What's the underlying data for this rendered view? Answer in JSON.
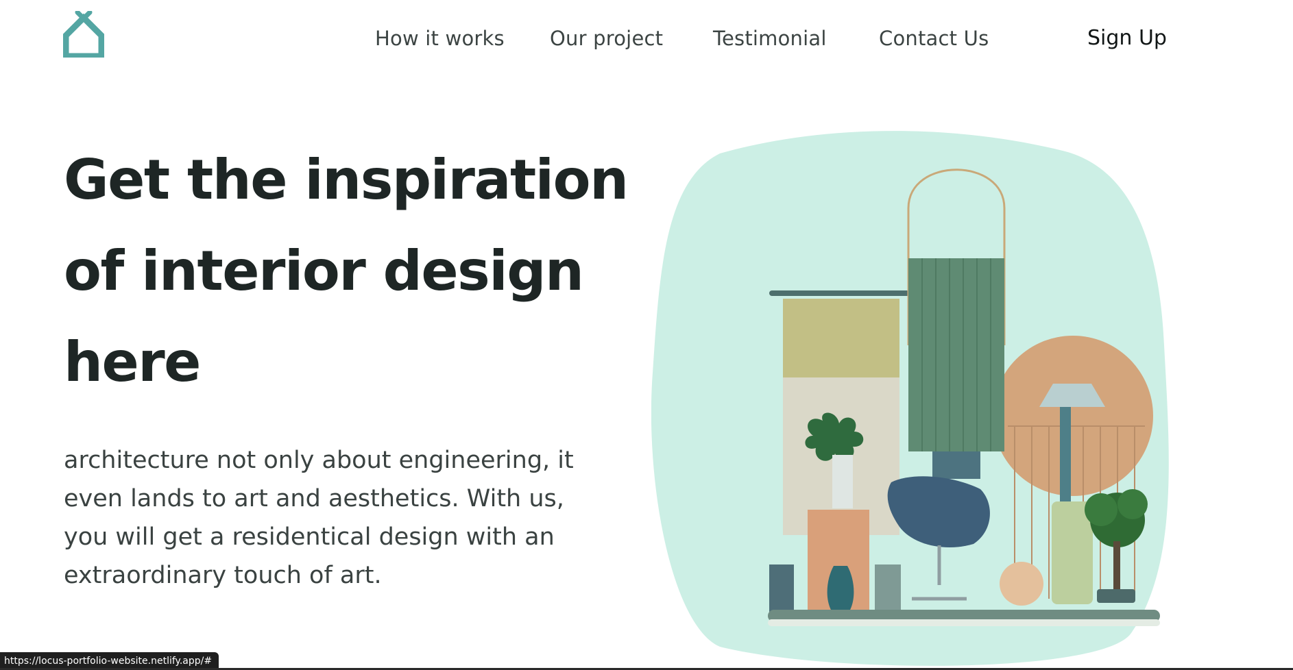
{
  "header": {
    "logo_icon": "house-icon",
    "nav": [
      {
        "label": "How it works"
      },
      {
        "label": "Our project"
      },
      {
        "label": "Testimonial"
      },
      {
        "label": "Contact Us"
      }
    ],
    "signup_label": "Sign Up"
  },
  "hero": {
    "title": "Get the inspiration of interior design here",
    "description": "architecture not only about engineering, it even lands to art and aesthetics. With us, you will get a residentical design with an extraordinary touch of art."
  },
  "illustration": {
    "name": "interior-design-collage",
    "background_color": "#ccefe5"
  },
  "statusbar": {
    "url": "https://locus-portfolio-website.netlify.app/#"
  },
  "colors": {
    "brand": "#54a6a3",
    "heading": "#1e2625",
    "body": "#3a4241"
  }
}
